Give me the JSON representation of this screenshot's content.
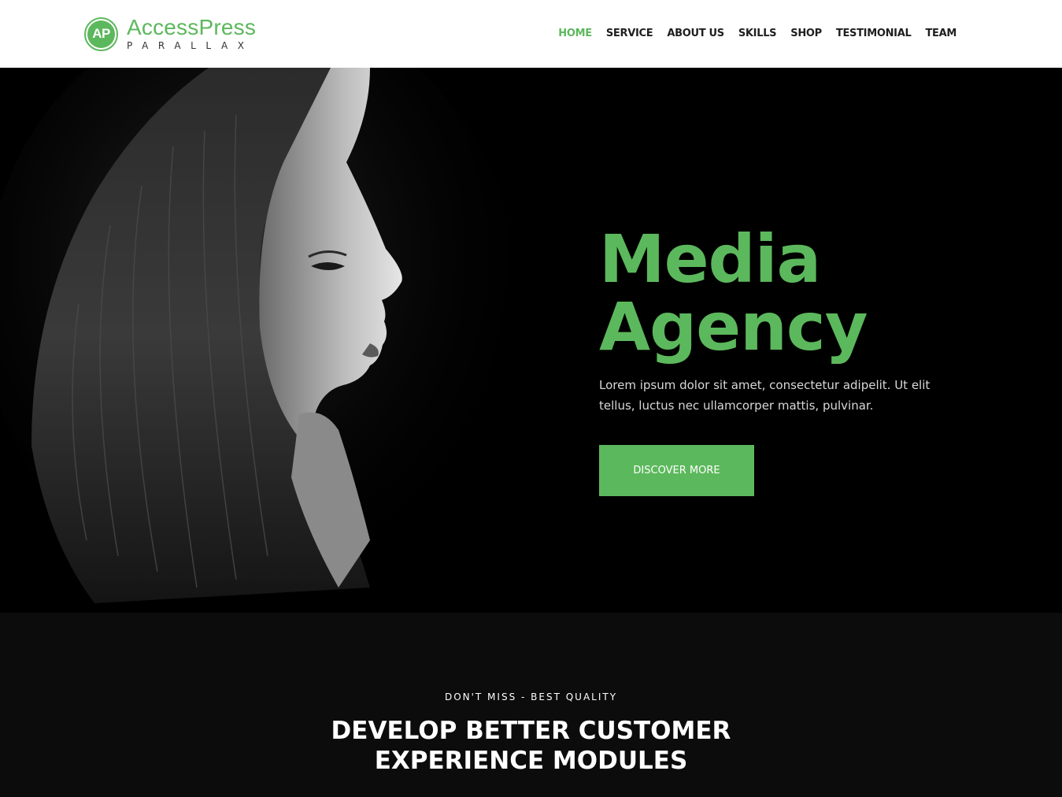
{
  "brand": {
    "badge": "AP",
    "name": "AccessPress",
    "tagline": "PARALLAX",
    "accent_color": "#5cb85c"
  },
  "nav": {
    "items": [
      {
        "label": "HOME",
        "active": true
      },
      {
        "label": "SERVICE"
      },
      {
        "label": "ABOUT US"
      },
      {
        "label": "SKILLS"
      },
      {
        "label": "SHOP"
      },
      {
        "label": "TESTIMONIAL"
      },
      {
        "label": "TEAM"
      }
    ]
  },
  "hero": {
    "title_line1": "Media",
    "title_line2": "Agency",
    "description": "Lorem ipsum dolor sit amet, consectetur adipelit. Ut elit tellus, luctus nec ullamcorper mattis, pulvinar.",
    "button_label": "DISCOVER MORE",
    "image": "woman-profile-portrait"
  },
  "section": {
    "eyebrow": "DON'T MISS - BEST QUALITY",
    "title_line1": "DEVELOP BETTER CUSTOMER",
    "title_line2": "EXPERIENCE MODULES"
  }
}
